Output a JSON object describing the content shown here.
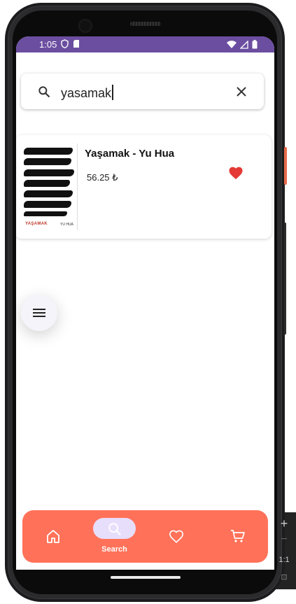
{
  "status_bar": {
    "time": "1:05"
  },
  "search": {
    "query": "yasamak"
  },
  "results": [
    {
      "title": "Yaşamak - Yu Hua",
      "price": "56.25 ₺",
      "cover_title": "YAŞAMAK",
      "cover_author": "YU HUA",
      "favorite": true
    }
  ],
  "nav": {
    "items": [
      {
        "id": "home",
        "icon": "home-icon",
        "label": ""
      },
      {
        "id": "search",
        "icon": "search-icon",
        "label": "Search",
        "active": true
      },
      {
        "id": "favorites",
        "icon": "heart-icon",
        "label": ""
      },
      {
        "id": "cart",
        "icon": "cart-icon",
        "label": ""
      }
    ]
  },
  "emulator_toolbar": {
    "ratio_label": "1:1"
  },
  "colors": {
    "status_bar": "#6b4ea0",
    "nav_background": "#ff7259",
    "nav_active_pill": "#e7defc",
    "favorite_heart": "#e53935"
  }
}
